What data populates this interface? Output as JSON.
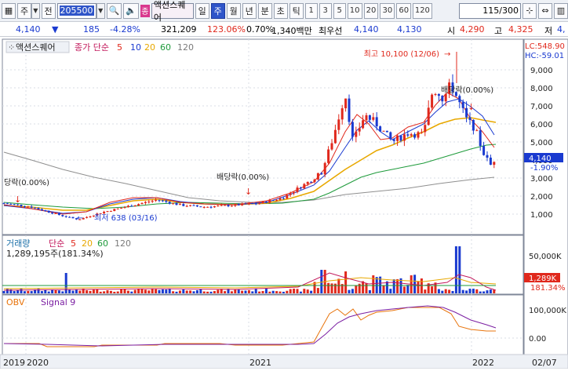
{
  "toolbar": {
    "market_label": "주",
    "type_label": "전",
    "code_value": "205500",
    "stock_badge": "종",
    "stock_name": "액션스퀘어",
    "periods": [
      "일",
      "주",
      "월",
      "년",
      "분",
      "초",
      "틱"
    ],
    "active_period": "주",
    "intervals": [
      "1",
      "3",
      "5",
      "10",
      "20",
      "30",
      "60",
      "120"
    ],
    "page_count": "115",
    "page_total": "/300"
  },
  "quote": {
    "price": "4,140",
    "change": "185",
    "change_pct": "-4.28%",
    "volume": "321,209",
    "vol_ratio": "123.06%",
    "turnover": "0.70%",
    "amount": "1,340백만",
    "label_best": "최우선",
    "best_ask": "4,140",
    "best_bid": "4,130",
    "label_open": "시",
    "open": "4,290",
    "label_high": "고",
    "high": "4,325",
    "label_low": "저",
    "low": "4,"
  },
  "price_panel": {
    "name_tag": "액션스퀘어",
    "ma_label": "종가 단순",
    "ma_periods": [
      "5",
      "10",
      "20",
      "60",
      "120"
    ],
    "ma_colors": [
      "#e0281c",
      "#1a3ad0",
      "#e8a800",
      "#1d9a3a",
      "#7a7a7a"
    ],
    "lc_label": "LC:548.90",
    "hc_label": "HC:-59.01",
    "y_ticks": [
      "9,000",
      "8,000",
      "7,000",
      "6,000",
      "5,000",
      "4,000",
      "3,000",
      "2,000",
      "1,000"
    ],
    "last_price": "4,140",
    "last_change": "-1.90%",
    "annotations": {
      "high": "최고 10,100 (12/06)",
      "low": "최저 638 (03/16)",
      "dividend_1": "배당락(0.00%)",
      "dividend_2": "배당락(0.00%)",
      "dividend_3": "당락(0.00%)"
    }
  },
  "volume_panel": {
    "label": "거래량",
    "ma_label": "단순",
    "ma_periods": [
      "5",
      "20",
      "60",
      "120"
    ],
    "value_text": "1,289,195주(181.34%)",
    "y_tick": "50,000K",
    "last_value": "1,289K",
    "last_pct": "181.34%"
  },
  "obv_panel": {
    "label": "OBV",
    "signal_label": "Signal 9",
    "y_ticks": [
      "100,000K",
      "0.00"
    ]
  },
  "x_axis": {
    "labels": [
      "2019",
      "2020",
      "2021",
      "2022",
      "02/07"
    ]
  },
  "colors": {
    "up": "#e0281c",
    "down": "#1a3ad0",
    "accent": "#2f55c9"
  }
}
